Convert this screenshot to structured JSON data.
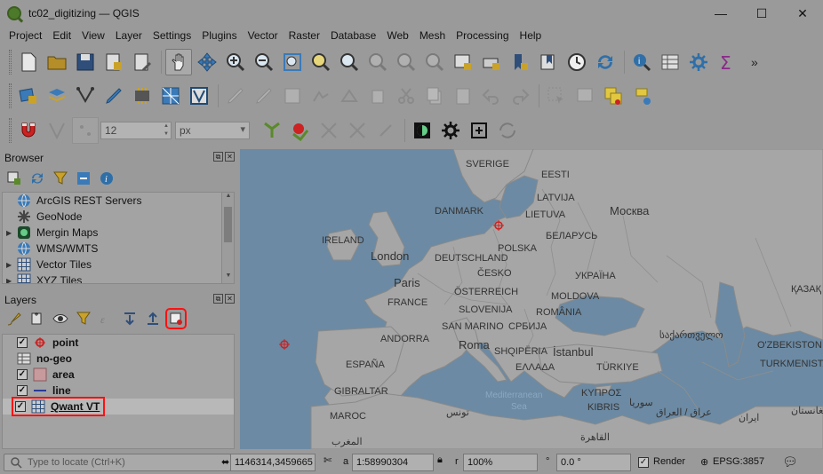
{
  "window": {
    "title": "tc02_digitizing — QGIS",
    "minimize": "—",
    "maximize": "☐",
    "close": "✕"
  },
  "menu": [
    "Project",
    "Edit",
    "View",
    "Layer",
    "Settings",
    "Plugins",
    "Vector",
    "Raster",
    "Database",
    "Web",
    "Mesh",
    "Processing",
    "Help"
  ],
  "toolbar_overflow": "»",
  "snapping": {
    "tolerance": "12",
    "unit": "px"
  },
  "browser": {
    "title": "Browser",
    "items": [
      {
        "label": "ArcGIS REST Servers",
        "icon": "arcgis-globe-icon",
        "expandable": false
      },
      {
        "label": "GeoNode",
        "icon": "geonode-icon",
        "expandable": false
      },
      {
        "label": "Mergin Maps",
        "icon": "mergin-maps-icon",
        "expandable": true
      },
      {
        "label": "WMS/WMTS",
        "icon": "wms-globe-icon",
        "expandable": false
      },
      {
        "label": "Vector Tiles",
        "icon": "vector-tiles-icon",
        "expandable": true
      },
      {
        "label": "XYZ Tiles",
        "icon": "xyz-tiles-icon",
        "expandable": true
      }
    ]
  },
  "layers": {
    "title": "Layers",
    "items": [
      {
        "label": "point",
        "checked": true,
        "icon": "point-symbol-icon"
      },
      {
        "label": "no-geo",
        "checked": false,
        "icon": "table-icon"
      },
      {
        "label": "area",
        "checked": true,
        "icon": "polygon-symbol-icon"
      },
      {
        "label": "line",
        "checked": true,
        "icon": "line-symbol-icon"
      },
      {
        "label": "Qwant VT",
        "checked": true,
        "icon": "vector-tile-layer-icon"
      }
    ]
  },
  "map_labels": {
    "sverige": "SVERIGE",
    "eesti": "EESTI",
    "latvija": "LATVIJA",
    "lietuva": "LIETUVA",
    "danmark": "DANMARK",
    "moskva": "Москва",
    "ireland": "IRELAND",
    "belarus": "БЕЛАРУСЬ",
    "london": "London",
    "deutschland": "DEUTSCHLAND",
    "polska": "POLSKA",
    "cesko": "ČESKO",
    "ukraine": "УКРАЇНА",
    "paris": "Paris",
    "osterreich": "ÖSTERREICH",
    "moldova": "MOLDOVA",
    "france": "FRANCE",
    "slovenija": "SLOVENIJA",
    "romania": "ROMÂNIA",
    "kazakh": "ҚАЗАҚ",
    "andorra": "ANDORRA",
    "sanmarino": "SAN MARINO",
    "srbija": "СРБИЈА",
    "georgia": "საქართველო",
    "roma": "Roma",
    "shqiperia": "SHQIPËRIA",
    "istanbul": "İstanbul",
    "uzbek": "O'ZBEKISTON",
    "espana": "ESPAÑA",
    "ellada": "ΕΛΛΑΔΑ",
    "turkiye": "TÜRKIYE",
    "turkmenistan": "TURKMENISTAN",
    "gibraltar": "GIBRALTAR",
    "medsea1": "Mediterranean",
    "medsea2": "Sea",
    "kypros": "ΚΥΠΡΟΣ",
    "kibris": "KIBRIS",
    "syria": "سوريا",
    "iraq": "عراق / العراق",
    "tunis": "تونس",
    "iran": "ایران",
    "maroc": "MAROC",
    "maghrib": "المغرب",
    "cairo": "القاهرة",
    "afghan": "افغانستان"
  },
  "status": {
    "locate_placeholder": "Type to locate (Ctrl+K)",
    "coordinate": "1146314,3459665",
    "scale_label": "a",
    "scale": "1:58990304",
    "magnifier_label": "r",
    "magnifier": "100%",
    "rotation_label": "°",
    "rotation": "0.0 °",
    "render_label": "Render",
    "render_checked": "✓",
    "crs": "EPSG:3857"
  }
}
